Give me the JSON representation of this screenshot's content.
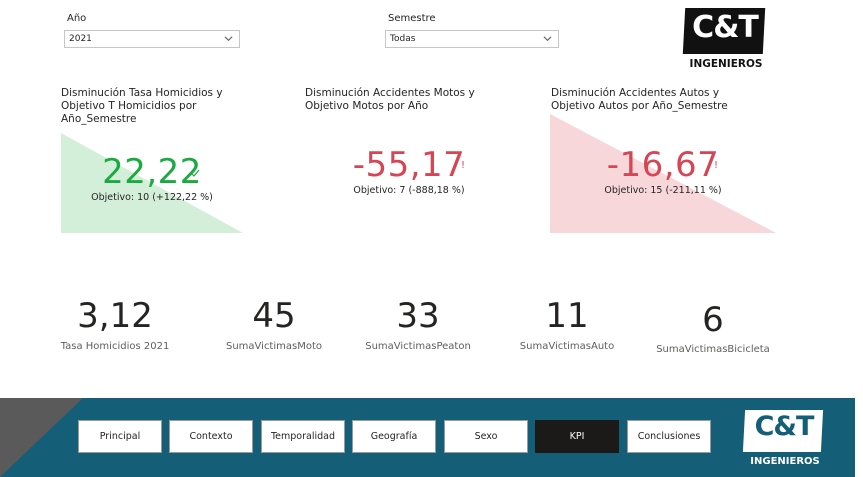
{
  "filters": {
    "year": {
      "label": "Año",
      "value": "2021"
    },
    "semester": {
      "label": "Semestre",
      "value": "Todas"
    }
  },
  "logo": {
    "letters": "C&T",
    "subtitle": "INGENIEROS"
  },
  "kpis": [
    {
      "title": "Disminución Tasa Homicidios y Objetivo T Homicidios por Año_Semestre",
      "value": "22,22",
      "goal": "Objetivo: 10 (+122,22 %)",
      "status_color": "#1aab40",
      "fill_color": "#d3efd9",
      "status_icon": "check-icon"
    },
    {
      "title": "Disminución Accidentes Motos y Objetivo Motos por Año",
      "value": "-55,17",
      "goal": "Objetivo: 7 (-888,18 %)",
      "status_color": "#d64554",
      "fill_color": "#ffffff",
      "status_icon": "exclamation-icon"
    },
    {
      "title": "Disminución Accidentes Autos y Objetivo Autos por Año_Semestre",
      "value": "-16,67",
      "goal": "Objetivo: 15 (-211,11 %)",
      "status_color": "#d64554",
      "fill_color": "#f7d7da",
      "status_icon": "exclamation-icon"
    }
  ],
  "cards": [
    {
      "value": "3,12",
      "label": "Tasa Homicidios 2021"
    },
    {
      "value": "45",
      "label": "SumaVictimasMoto"
    },
    {
      "value": "33",
      "label": "SumaVictimasPeaton"
    },
    {
      "value": "11",
      "label": "SumaVictimasAuto"
    },
    {
      "value": "6",
      "label": "SumaVictimasBicicleta"
    }
  ],
  "nav": {
    "buttons": [
      "Principal",
      "Contexto",
      "Temporalidad",
      "Geografía",
      "Sexo",
      "KPI",
      "Conclusiones"
    ],
    "active": "KPI"
  },
  "colors": {
    "footer_teal": "#145e78",
    "footer_gray": "#5a5a5a"
  }
}
